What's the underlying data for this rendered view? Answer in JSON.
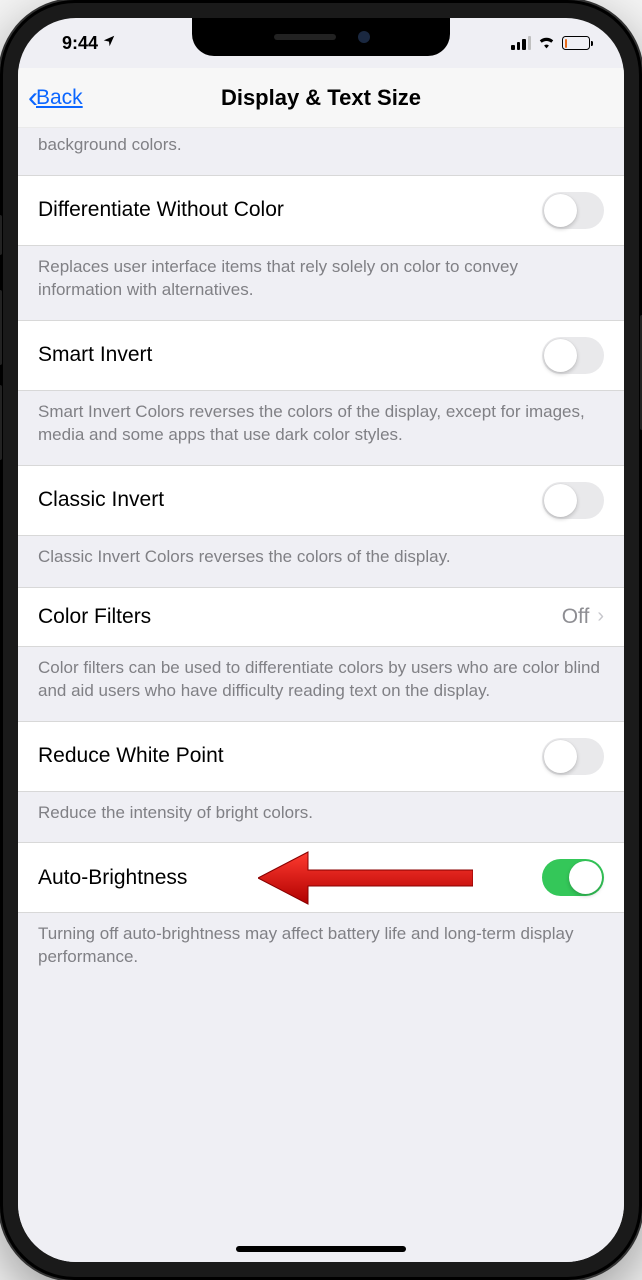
{
  "status": {
    "time": "9:44"
  },
  "nav": {
    "back": "Back",
    "title": "Display & Text Size"
  },
  "rows": {
    "partial_footer": "background colors.",
    "diff_without_color": {
      "label": "Differentiate Without Color",
      "on": false
    },
    "diff_footer": "Replaces user interface items that rely solely on color to convey information with alternatives.",
    "smart_invert": {
      "label": "Smart Invert",
      "on": false
    },
    "smart_footer": "Smart Invert Colors reverses the colors of the display, except for images, media and some apps that use dark color styles.",
    "classic_invert": {
      "label": "Classic Invert",
      "on": false
    },
    "classic_footer": "Classic Invert Colors reverses the colors of the display.",
    "color_filters": {
      "label": "Color Filters",
      "value": "Off"
    },
    "color_filters_footer": "Color filters can be used to differentiate colors by users who are color blind and aid users who have difficulty reading text on the display.",
    "reduce_white_point": {
      "label": "Reduce White Point",
      "on": false
    },
    "reduce_footer": "Reduce the intensity of bright colors.",
    "auto_brightness": {
      "label": "Auto-Brightness",
      "on": true
    },
    "auto_footer": "Turning off auto-brightness may affect battery life and long-term display performance."
  }
}
